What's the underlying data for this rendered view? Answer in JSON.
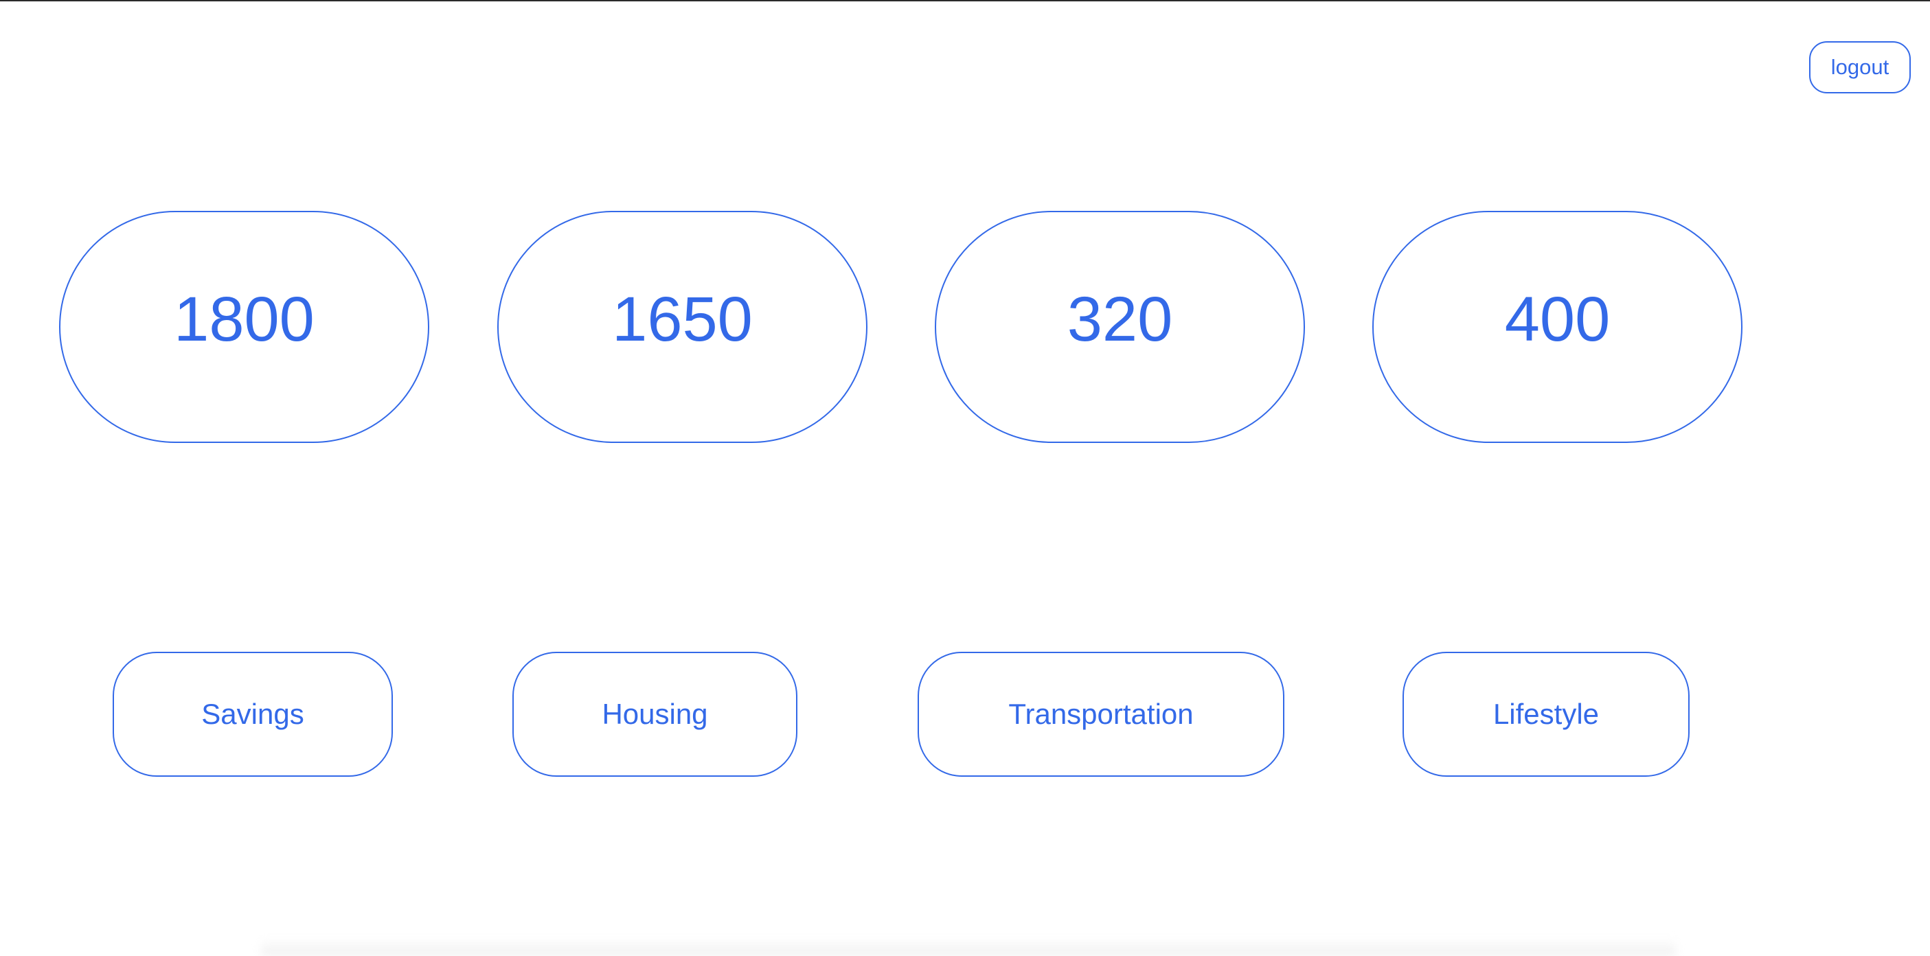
{
  "header": {
    "logout_label": "logout"
  },
  "amounts": [
    {
      "value": "1800"
    },
    {
      "value": "1650"
    },
    {
      "value": "320"
    },
    {
      "value": "400"
    }
  ],
  "categories": [
    {
      "label": "Savings"
    },
    {
      "label": "Housing"
    },
    {
      "label": "Transportation"
    },
    {
      "label": "Lifestyle"
    }
  ],
  "theme": {
    "accent": "#3369e8",
    "background": "#ffffff"
  }
}
